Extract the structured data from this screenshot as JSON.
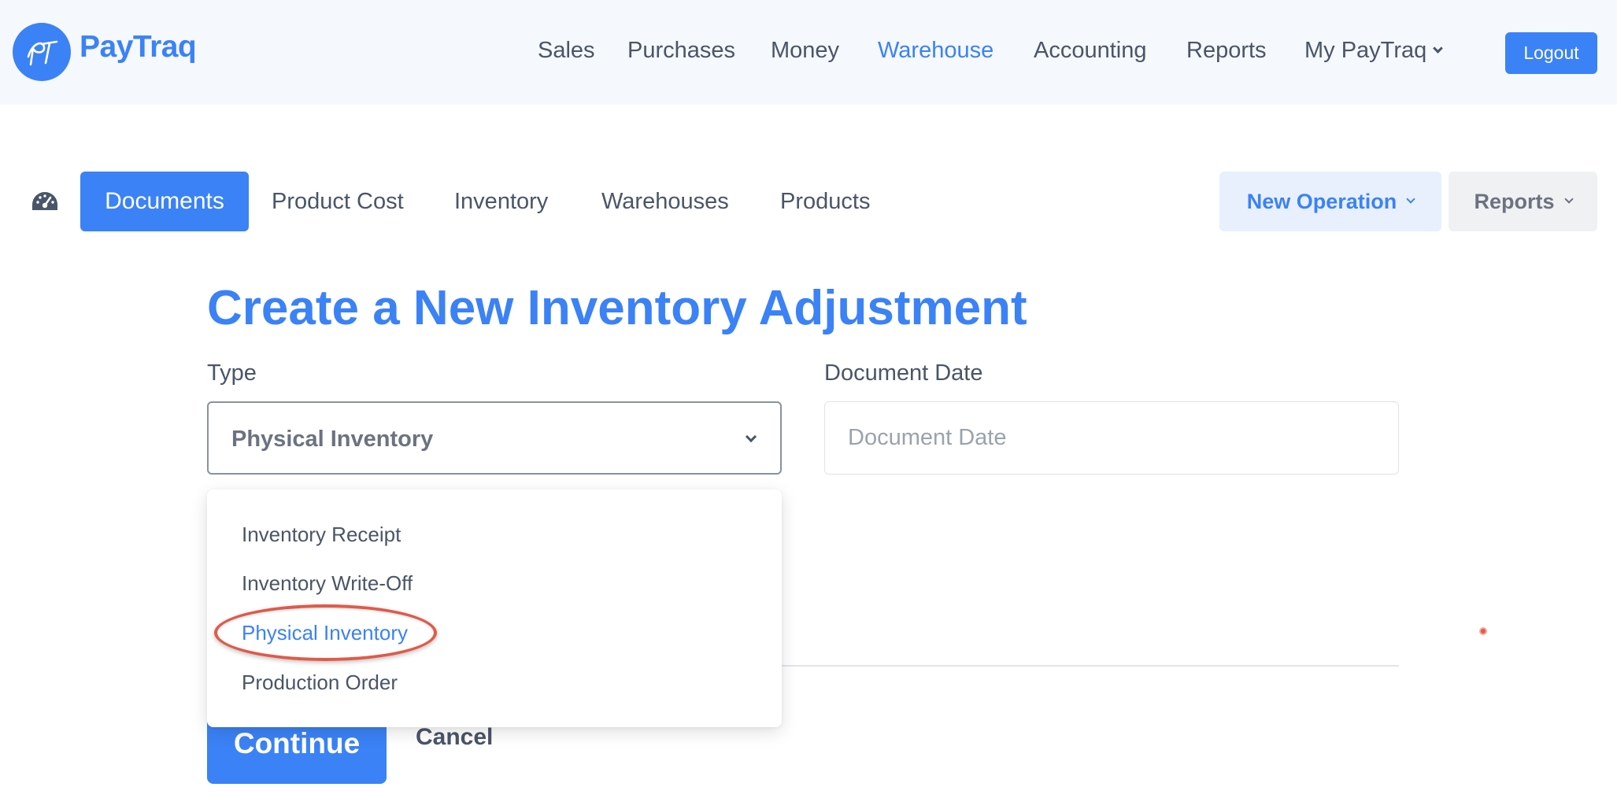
{
  "header": {
    "logo_text": "PT",
    "brand": "PayTraq",
    "nav": [
      "Sales",
      "Purchases",
      "Money",
      "Warehouse",
      "Accounting",
      "Reports",
      "My PayTraq"
    ],
    "active_nav": "Warehouse",
    "logout_label": "Logout"
  },
  "subnav": {
    "tabs": [
      "Documents",
      "Product Cost",
      "Inventory",
      "Warehouses",
      "Products"
    ],
    "active_tab": "Documents",
    "new_operation_label": "New Operation",
    "reports_label": "Reports"
  },
  "form": {
    "title": "Create a New Inventory Adjustment",
    "type_label": "Type",
    "type_value": "Physical Inventory",
    "date_label": "Document Date",
    "date_placeholder": "Document Date",
    "date_value": "",
    "continue_label": "Continue",
    "cancel_label": "Cancel"
  },
  "dropdown": {
    "options": [
      "Inventory Receipt",
      "Inventory Write-Off",
      "Physical Inventory",
      "Production Order"
    ],
    "selected": "Physical Inventory"
  },
  "colors": {
    "accent": "#3b82f6",
    "highlight": "#e05a48",
    "header_bg": "#f5f8fd"
  },
  "icons": {
    "dashboard": "dashboard-gauge-icon",
    "chevron": "chevron-down-icon"
  }
}
